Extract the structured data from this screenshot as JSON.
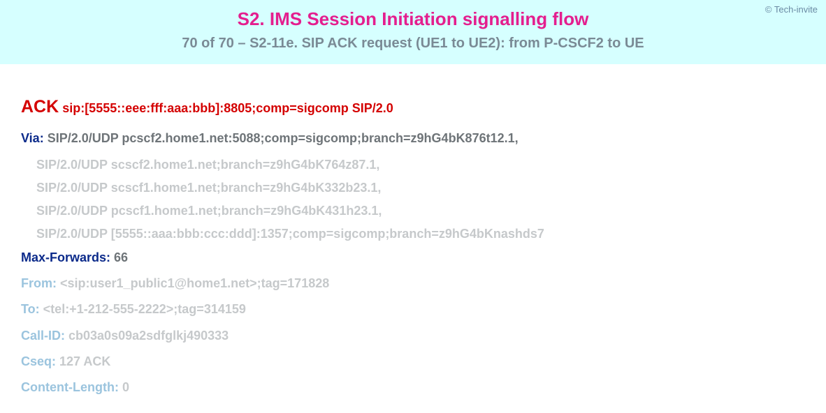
{
  "copyright": "© Tech-invite",
  "title": "S2. IMS Session Initiation signalling flow",
  "subtitle": "70 of 70 – S2-11e. SIP ACK request (UE1 to UE2): from P-CSCF2 to UE",
  "request": {
    "method": "ACK",
    "uri": "sip:[5555::eee:fff:aaa:bbb]:8805;comp=sigcomp SIP/2.0"
  },
  "via": {
    "label": "Via:",
    "first": "SIP/2.0/UDP pcscf2.home1.net:5088;comp=sigcomp;branch=z9hG4bK876t12.1,",
    "rest": [
      "SIP/2.0/UDP scscf2.home1.net;branch=z9hG4bK764z87.1,",
      "SIP/2.0/UDP scscf1.home1.net;branch=z9hG4bK332b23.1,",
      "SIP/2.0/UDP pcscf1.home1.net;branch=z9hG4bK431h23.1,",
      "SIP/2.0/UDP [5555::aaa:bbb:ccc:ddd]:1357;comp=sigcomp;branch=z9hG4bKnashds7"
    ]
  },
  "maxForwards": {
    "label": "Max-Forwards:",
    "value": "66"
  },
  "from": {
    "label": "From:",
    "value": "<sip:user1_public1@home1.net>;tag=171828"
  },
  "to": {
    "label": "To:",
    "value": "<tel:+1-212-555-2222>;tag=314159"
  },
  "callId": {
    "label": "Call-ID:",
    "value": "cb03a0s09a2sdfglkj490333"
  },
  "cseq": {
    "label": "Cseq:",
    "value": "127 ACK"
  },
  "contentLength": {
    "label": "Content-Length:",
    "value": "0"
  }
}
